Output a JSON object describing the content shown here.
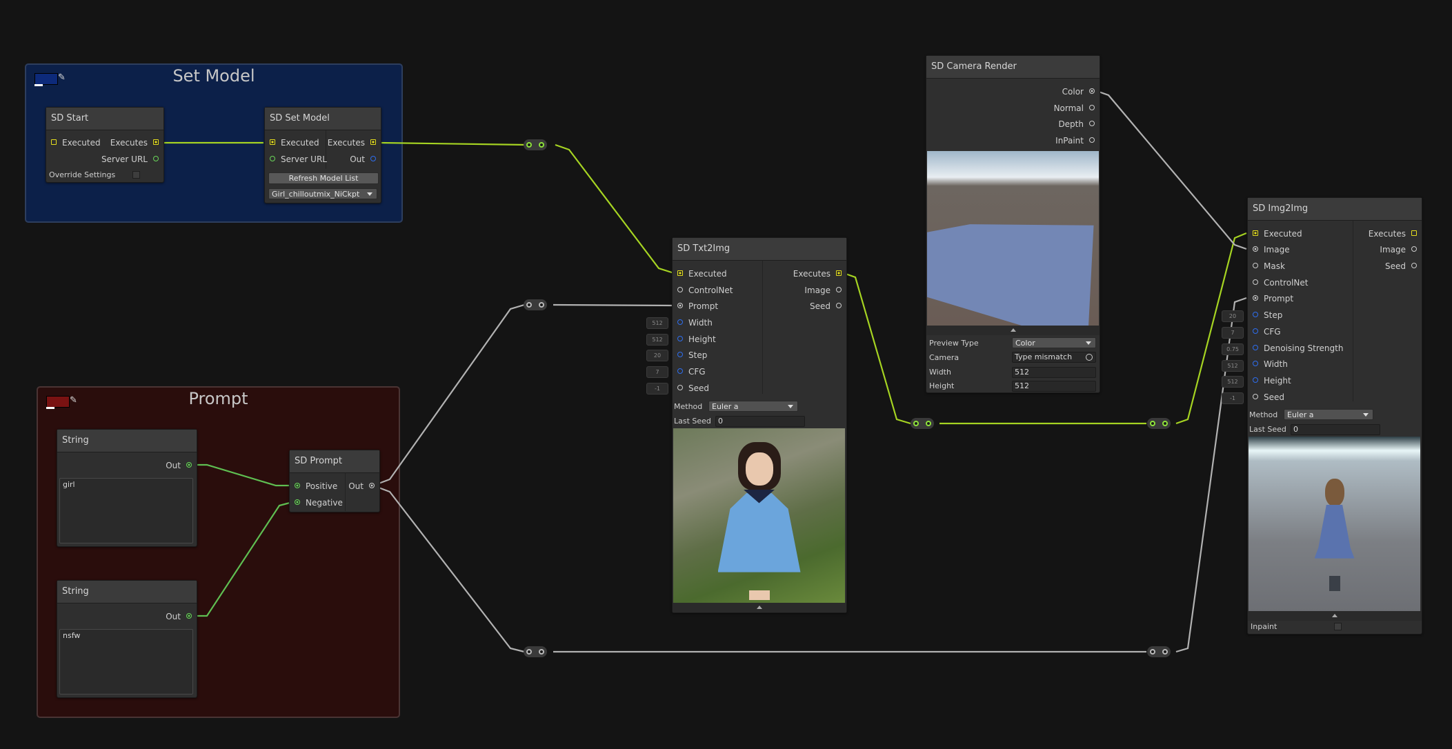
{
  "groups": {
    "set_model": {
      "title": "Set Model",
      "color": "#0c2049"
    },
    "prompt": {
      "title": "Prompt",
      "color": "#2a0d0c"
    }
  },
  "icons": {
    "color_picker": "eyedropper-icon"
  },
  "nodes": {
    "sd_start": {
      "title": "SD Start",
      "inputs": [
        "Executed"
      ],
      "outputs": [
        "Executes",
        "Server URL"
      ],
      "override_label": "Override Settings"
    },
    "sd_set_model": {
      "title": "SD Set Model",
      "inputs": [
        "Executed",
        "Server URL"
      ],
      "outputs": [
        "Executes",
        "Out"
      ],
      "refresh_button": "Refresh Model List",
      "model": "Girl_chilloutmix_NiCkpt"
    },
    "string_1": {
      "title": "String",
      "output": "Out",
      "text": "girl"
    },
    "string_2": {
      "title": "String",
      "output": "Out",
      "text": "nsfw"
    },
    "sd_prompt": {
      "title": "SD Prompt",
      "inputs": [
        "Positive",
        "Negative"
      ],
      "output": "Out"
    },
    "sd_txt2img": {
      "title": "SD Txt2Img",
      "inputs": [
        "Executed",
        "ControlNet",
        "Prompt",
        "Width",
        "Height",
        "Step",
        "CFG",
        "Seed"
      ],
      "outputs": [
        "Executes",
        "Image",
        "Seed"
      ],
      "defaults": [
        "512",
        "512",
        "20",
        "7",
        "-1"
      ],
      "method_label": "Method",
      "method_value": "Euler a",
      "last_seed_label": "Last Seed",
      "last_seed_value": "0"
    },
    "sd_camera_render": {
      "title": "SD Camera Render",
      "outputs": [
        "Color",
        "Normal",
        "Depth",
        "InPaint"
      ],
      "preview_type_label": "Preview Type",
      "preview_type_value": "Color",
      "camera_label": "Camera",
      "camera_value": "Type mismatch",
      "width_label": "Width",
      "width_value": "512",
      "height_label": "Height",
      "height_value": "512"
    },
    "sd_img2img": {
      "title": "SD Img2Img",
      "inputs": [
        "Executed",
        "Image",
        "Mask",
        "ControlNet",
        "Prompt",
        "Step",
        "CFG",
        "Denoising Strength",
        "Width",
        "Height",
        "Seed"
      ],
      "outputs": [
        "Executes",
        "Image",
        "Seed"
      ],
      "defaults": [
        "20",
        "7",
        "0.75",
        "512",
        "512",
        "-1"
      ],
      "method_label": "Method",
      "method_value": "Euler a",
      "last_seed_label": "Last Seed",
      "last_seed_value": "0",
      "inpaint_label": "Inpaint"
    }
  },
  "colors": {
    "exec_wire": "#a6d422",
    "value_wire": "#b2b2b2",
    "string_wire": "#5fbf52",
    "exec_port": "#e7e01f",
    "string_port": "#6ad75a",
    "number_port": "#2e6ef0"
  }
}
